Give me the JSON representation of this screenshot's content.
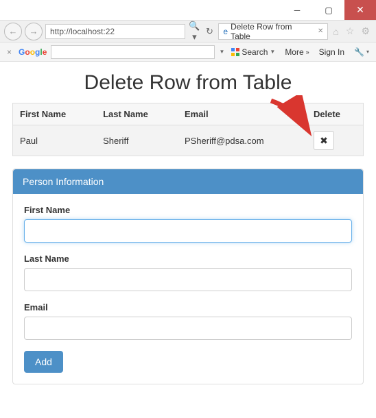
{
  "window": {
    "url": "http://localhost:22",
    "tab_title": "Delete Row from Table"
  },
  "google_bar": {
    "logo": "Google",
    "search_label": "Search",
    "more_label": "More",
    "signin_label": "Sign In"
  },
  "page": {
    "title": "Delete Row from Table"
  },
  "table": {
    "headers": {
      "first": "First Name",
      "last": "Last Name",
      "email": "Email",
      "del": "Delete"
    },
    "rows": [
      {
        "first": "Paul",
        "last": "Sheriff",
        "email": "PSheriff@pdsa.com"
      }
    ]
  },
  "form": {
    "panel_title": "Person Information",
    "labels": {
      "first": "First Name",
      "last": "Last Name",
      "email": "Email"
    },
    "values": {
      "first": "",
      "last": "",
      "email": ""
    },
    "add_label": "Add"
  }
}
